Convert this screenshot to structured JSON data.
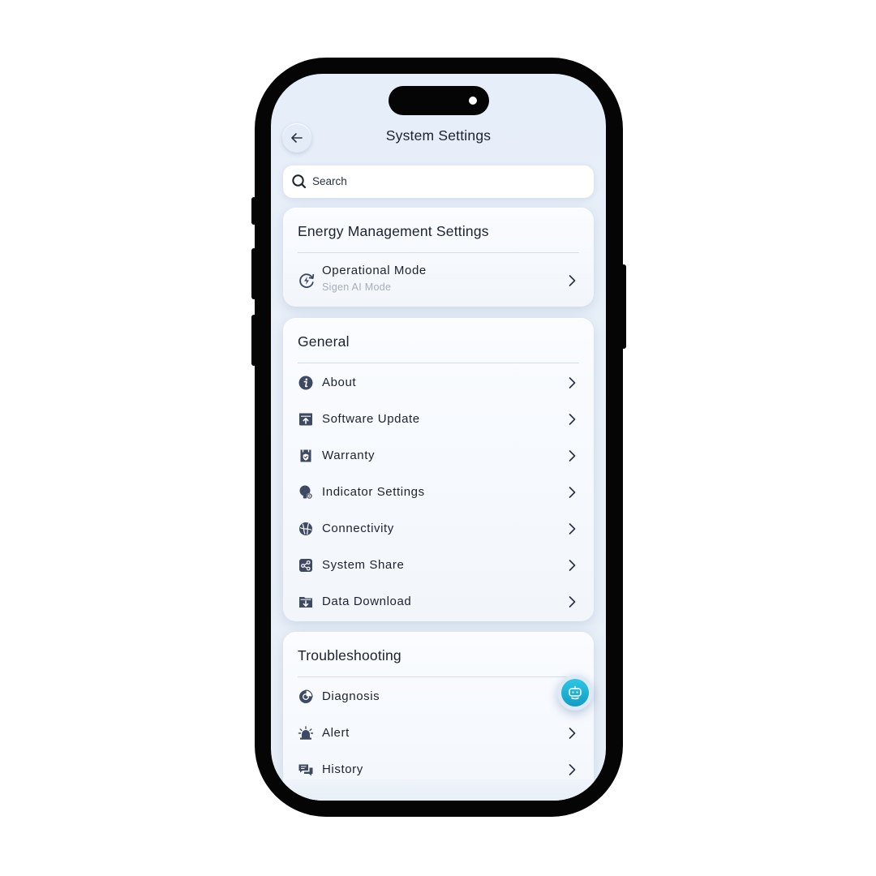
{
  "header": {
    "title": "System Settings"
  },
  "search": {
    "placeholder": "Search"
  },
  "energy": {
    "title": "Energy Management Settings",
    "items": [
      {
        "label": "Operational Mode",
        "value": "Sigen AI Mode",
        "icon": "operational-mode-icon"
      }
    ]
  },
  "general": {
    "title": "General",
    "items": [
      {
        "label": "About",
        "icon": "info-icon"
      },
      {
        "label": "Software Update",
        "icon": "software-update-icon"
      },
      {
        "label": "Warranty",
        "icon": "warranty-icon"
      },
      {
        "label": "Indicator Settings",
        "icon": "indicator-icon"
      },
      {
        "label": "Connectivity",
        "icon": "connectivity-icon"
      },
      {
        "label": "System Share",
        "icon": "share-icon"
      },
      {
        "label": "Data Download",
        "icon": "download-icon"
      }
    ]
  },
  "troubleshooting": {
    "title": "Troubleshooting",
    "items": [
      {
        "label": "Diagnosis",
        "icon": "diagnosis-icon"
      },
      {
        "label": "Alert",
        "icon": "alert-icon"
      },
      {
        "label": "History",
        "icon": "history-icon"
      }
    ]
  },
  "colors": {
    "accent": "#1ab3d8",
    "text": "#1c2230",
    "icon": "#3e4a63",
    "subtext": "#a7aebb"
  }
}
